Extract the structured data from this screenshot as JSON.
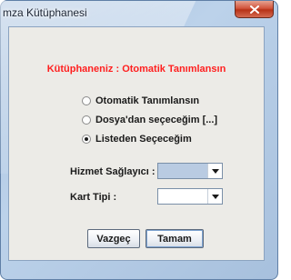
{
  "window": {
    "title": "mza Kütüphanesi",
    "close_icon": "close-icon"
  },
  "dialog": {
    "heading": "Kütüphaneniz : Otomatik Tanımlansın",
    "options": [
      {
        "label": "Otomatik Tanımlansın",
        "selected": false
      },
      {
        "label": "Dosya'dan seçeceğim [...]",
        "selected": false
      },
      {
        "label": "Listeden Seçeceğim",
        "selected": true
      }
    ],
    "provider_label": "Hizmet Sağlayıcı :",
    "provider_value": "",
    "card_type_label": "Kart Tipi :",
    "card_type_value": "",
    "cancel_label": "Vazgeç",
    "ok_label": "Tamam"
  },
  "colors": {
    "heading": "#ff1f1f",
    "client_background": "#ecebe7",
    "close_button": "#c8442a"
  }
}
